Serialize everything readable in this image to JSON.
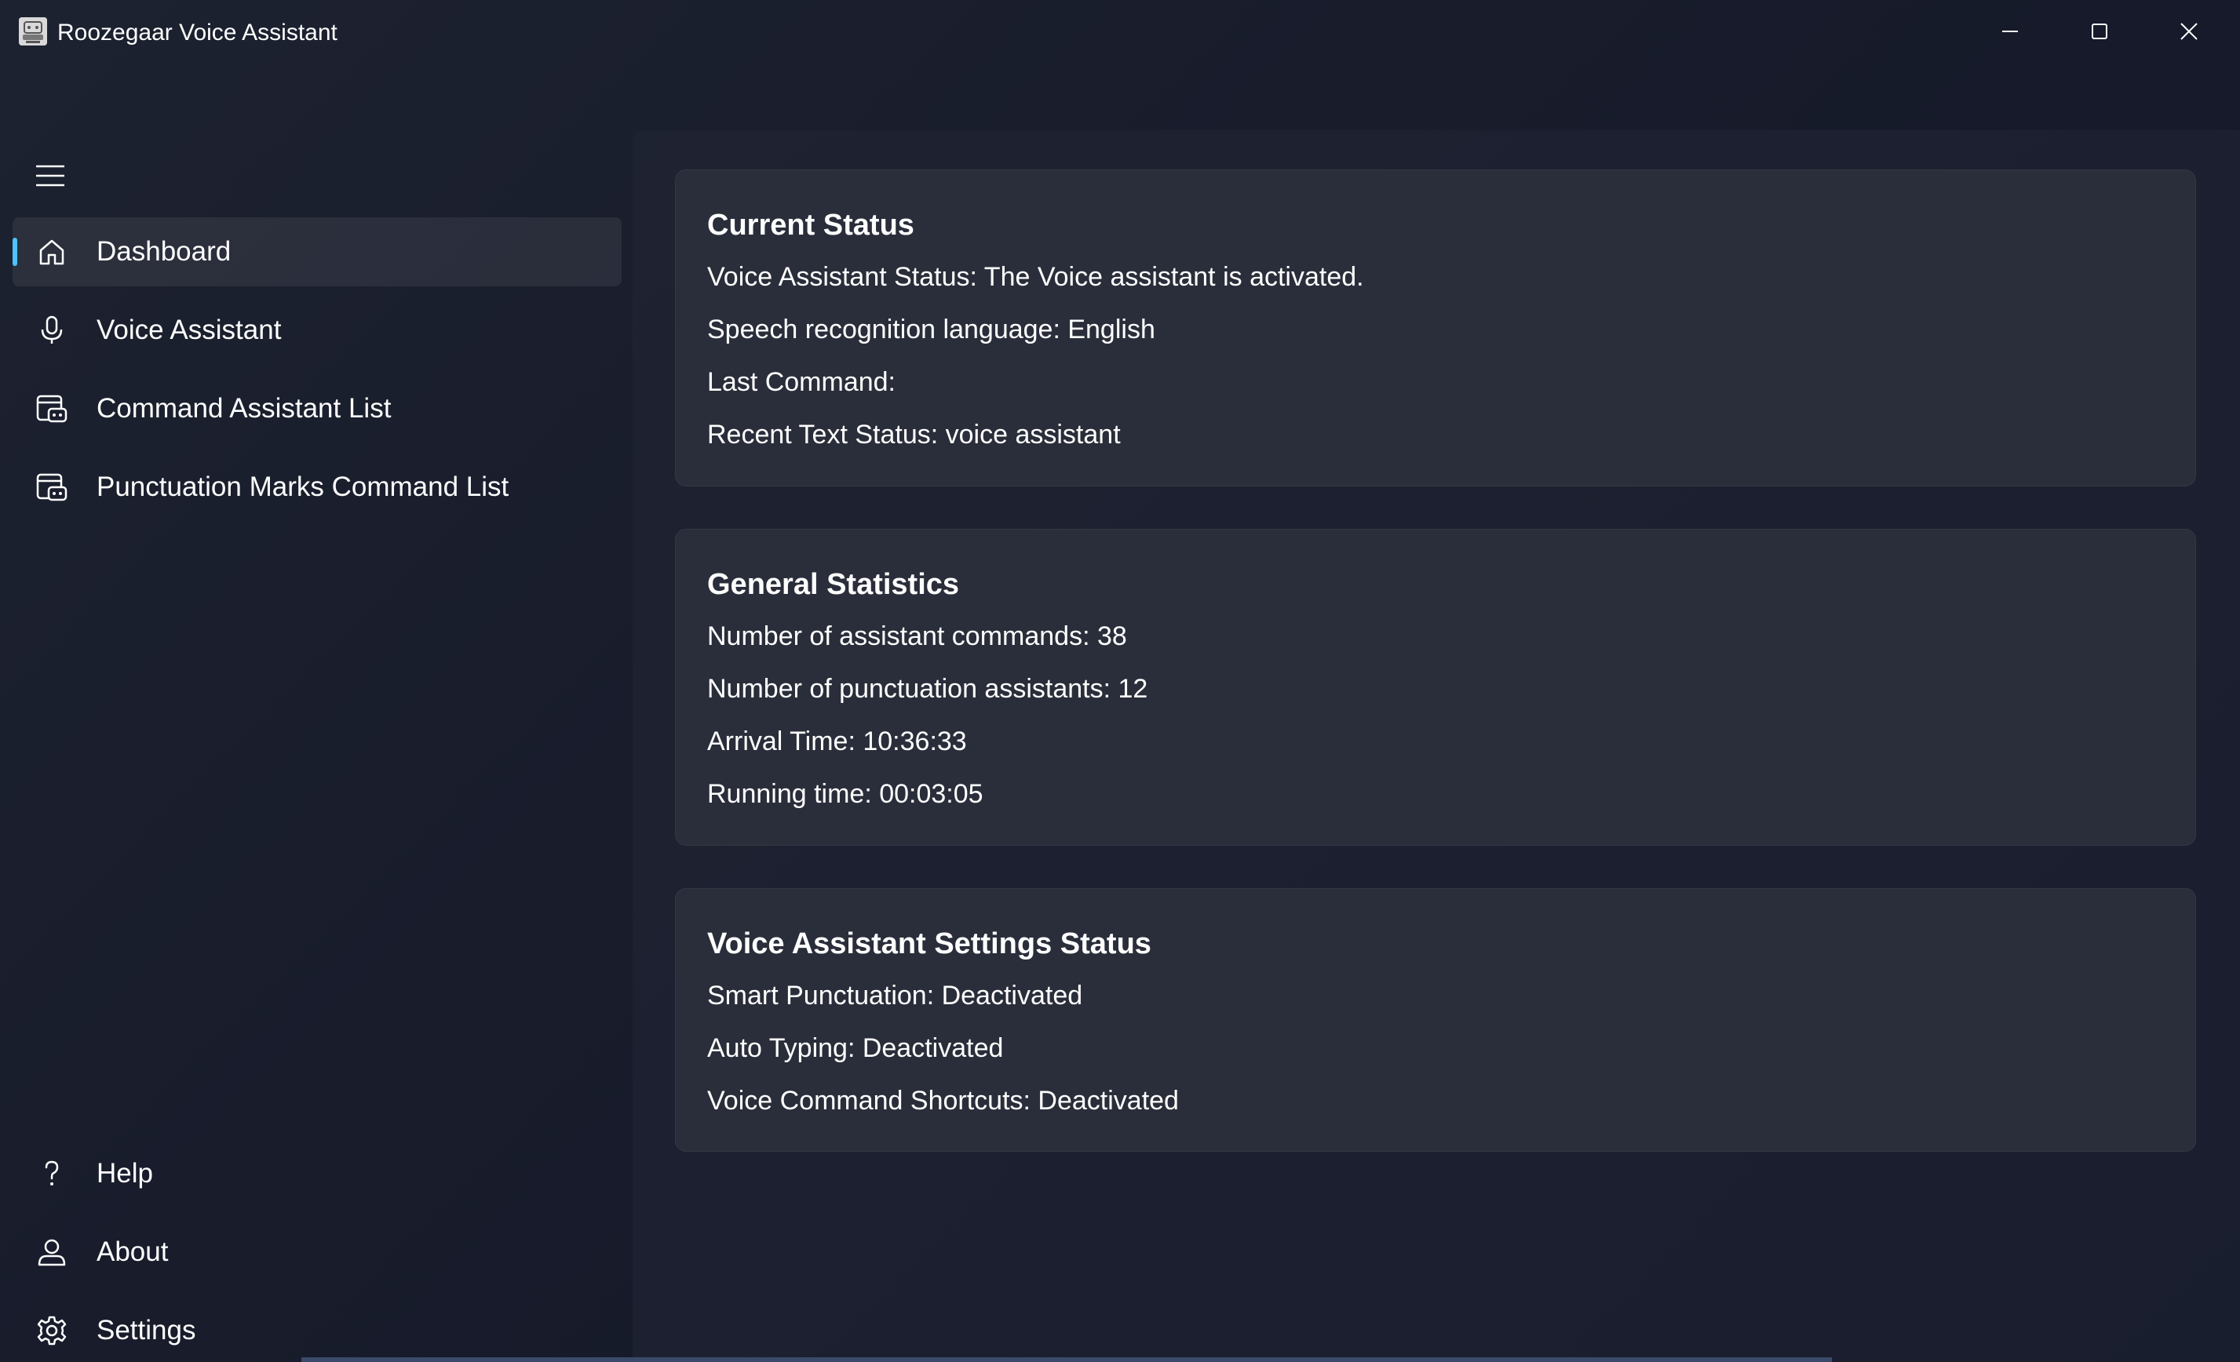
{
  "window": {
    "title": "Roozegaar Voice Assistant"
  },
  "sidebar": {
    "items": [
      {
        "label": "Dashboard",
        "icon": "home-icon",
        "selected": true
      },
      {
        "label": "Voice Assistant",
        "icon": "microphone-icon",
        "selected": false
      },
      {
        "label": "Command Assistant List",
        "icon": "command-list-icon",
        "selected": false
      },
      {
        "label": "Punctuation Marks Command List",
        "icon": "command-list-icon",
        "selected": false
      }
    ],
    "footer_items": [
      {
        "label": "Help",
        "icon": "help-icon"
      },
      {
        "label": "About",
        "icon": "person-icon"
      },
      {
        "label": "Settings",
        "icon": "gear-icon"
      }
    ]
  },
  "cards": [
    {
      "title": "Current Status",
      "lines": [
        "Voice Assistant Status: The Voice assistant is activated.",
        "Speech recognition language: English",
        "Last Command:",
        "Recent Text Status: voice assistant"
      ]
    },
    {
      "title": "General Statistics",
      "lines": [
        "Number of assistant commands: 38",
        "Number of punctuation assistants: 12",
        "Arrival Time: 10:36:33",
        "Running time: 00:03:05"
      ]
    },
    {
      "title": "Voice Assistant Settings Status",
      "lines": [
        "Smart Punctuation: Deactivated",
        "Auto Typing: Deactivated",
        "Voice Command Shortcuts: Deactivated"
      ]
    }
  ],
  "colors": {
    "accent": "#4cc2ff",
    "card_background": "#2a2e3a",
    "window_background": "#181c2b"
  }
}
